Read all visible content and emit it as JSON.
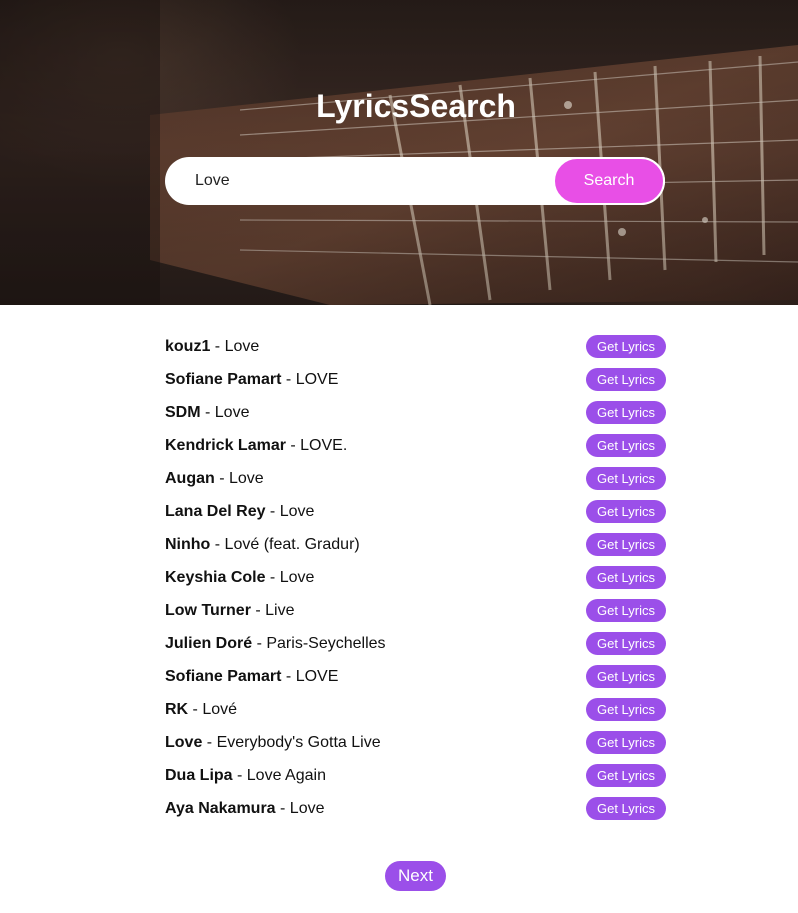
{
  "header": {
    "title": "LyricsSearch"
  },
  "search": {
    "value": "Love",
    "button_label": "Search"
  },
  "results": {
    "button_label": "Get Lyrics",
    "separator": " - ",
    "items": [
      {
        "artist": "kouz1",
        "title": "Love"
      },
      {
        "artist": "Sofiane Pamart",
        "title": "LOVE"
      },
      {
        "artist": "SDM",
        "title": "Love"
      },
      {
        "artist": "Kendrick Lamar",
        "title": "LOVE."
      },
      {
        "artist": "Augan",
        "title": "Love"
      },
      {
        "artist": "Lana Del Rey",
        "title": "Love"
      },
      {
        "artist": "Ninho",
        "title": "Lové (feat. Gradur)"
      },
      {
        "artist": "Keyshia Cole",
        "title": "Love"
      },
      {
        "artist": "Low Turner",
        "title": "Live"
      },
      {
        "artist": "Julien Doré",
        "title": "Paris-Seychelles"
      },
      {
        "artist": "Sofiane Pamart",
        "title": "LOVE"
      },
      {
        "artist": "RK",
        "title": "Lové"
      },
      {
        "artist": "Love",
        "title": "Everybody's Gotta Live"
      },
      {
        "artist": "Dua Lipa",
        "title": "Love Again"
      },
      {
        "artist": "Aya Nakamura",
        "title": "Love"
      }
    ]
  },
  "pagination": {
    "next_label": "Next"
  },
  "colors": {
    "search_button": "#e84fe6",
    "lyrics_button": "#9b4fe9",
    "next_button": "#9b4fe9"
  }
}
